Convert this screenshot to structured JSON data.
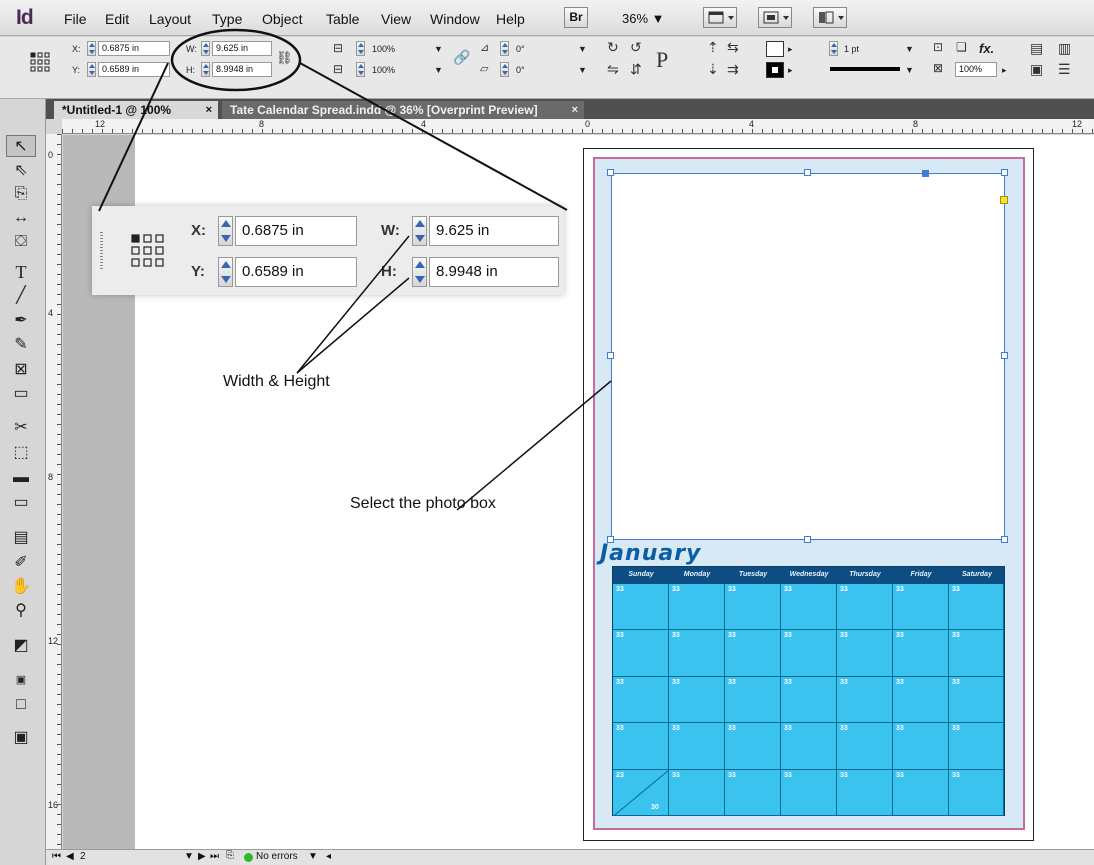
{
  "app": {
    "logo": "Id"
  },
  "menu": {
    "items": [
      "File",
      "Edit",
      "Layout",
      "Type",
      "Object",
      "Table",
      "View",
      "Window",
      "Help"
    ],
    "bridge": "Br",
    "zoom": "36% ▼"
  },
  "control_panel": {
    "x_label": "X:",
    "x_value": "0.6875 in",
    "y_label": "Y:",
    "y_value": "0.6589 in",
    "w_label": "W:",
    "w_value": "9.625 in",
    "h_label": "H:",
    "h_value": "8.9948 in",
    "scale_x": "100%",
    "scale_y": "100%",
    "rotate": "0°",
    "shear": "0°",
    "stroke_weight": "1 pt",
    "opacity": "100%",
    "fx": "fx."
  },
  "tabs": [
    {
      "label": "*Untitled-1 @ 100%",
      "close": "×"
    },
    {
      "label": "Tate Calendar Spread.indd @ 36% [Overprint Preview]",
      "close": "×"
    }
  ],
  "rulers": {
    "h_labels": [
      "12",
      "8",
      "4",
      "0",
      "4",
      "8",
      "12"
    ],
    "v_labels": [
      "0",
      "4",
      "8",
      "12",
      "16"
    ]
  },
  "zoom_callout": {
    "x_label": "X:",
    "x_value": "0.6875 in",
    "y_label": "Y:",
    "y_value": "0.6589 in",
    "w_label": "W:",
    "w_value": "9.625 in",
    "h_label": "H:",
    "h_value": "8.9948 in"
  },
  "annotations": {
    "width_height": "Width & Height",
    "select_photo": "Select the photo box"
  },
  "calendar": {
    "month": "January",
    "days": [
      "Sunday",
      "Monday",
      "Tuesday",
      "Wednesday",
      "Thursday",
      "Friday",
      "Saturday"
    ],
    "rows": [
      [
        "33",
        "33",
        "33",
        "33",
        "33",
        "33",
        "33"
      ],
      [
        "33",
        "33",
        "33",
        "33",
        "33",
        "33",
        "33"
      ],
      [
        "33",
        "33",
        "33",
        "33",
        "33",
        "33",
        "33"
      ],
      [
        "33",
        "33",
        "33",
        "33",
        "33",
        "33",
        "33"
      ],
      [
        "23",
        "33",
        "33",
        "33",
        "33",
        "33",
        "33"
      ]
    ],
    "split_cell_bottom": "30"
  },
  "status": {
    "page_number": "2",
    "errors": "No errors"
  },
  "colors": {
    "calendar_cell": "#39c3ee",
    "calendar_header": "#0e4d82",
    "month_title": "#0c5ea4",
    "selection": "#3f7bd8",
    "status_ok": "#2eb82e"
  }
}
